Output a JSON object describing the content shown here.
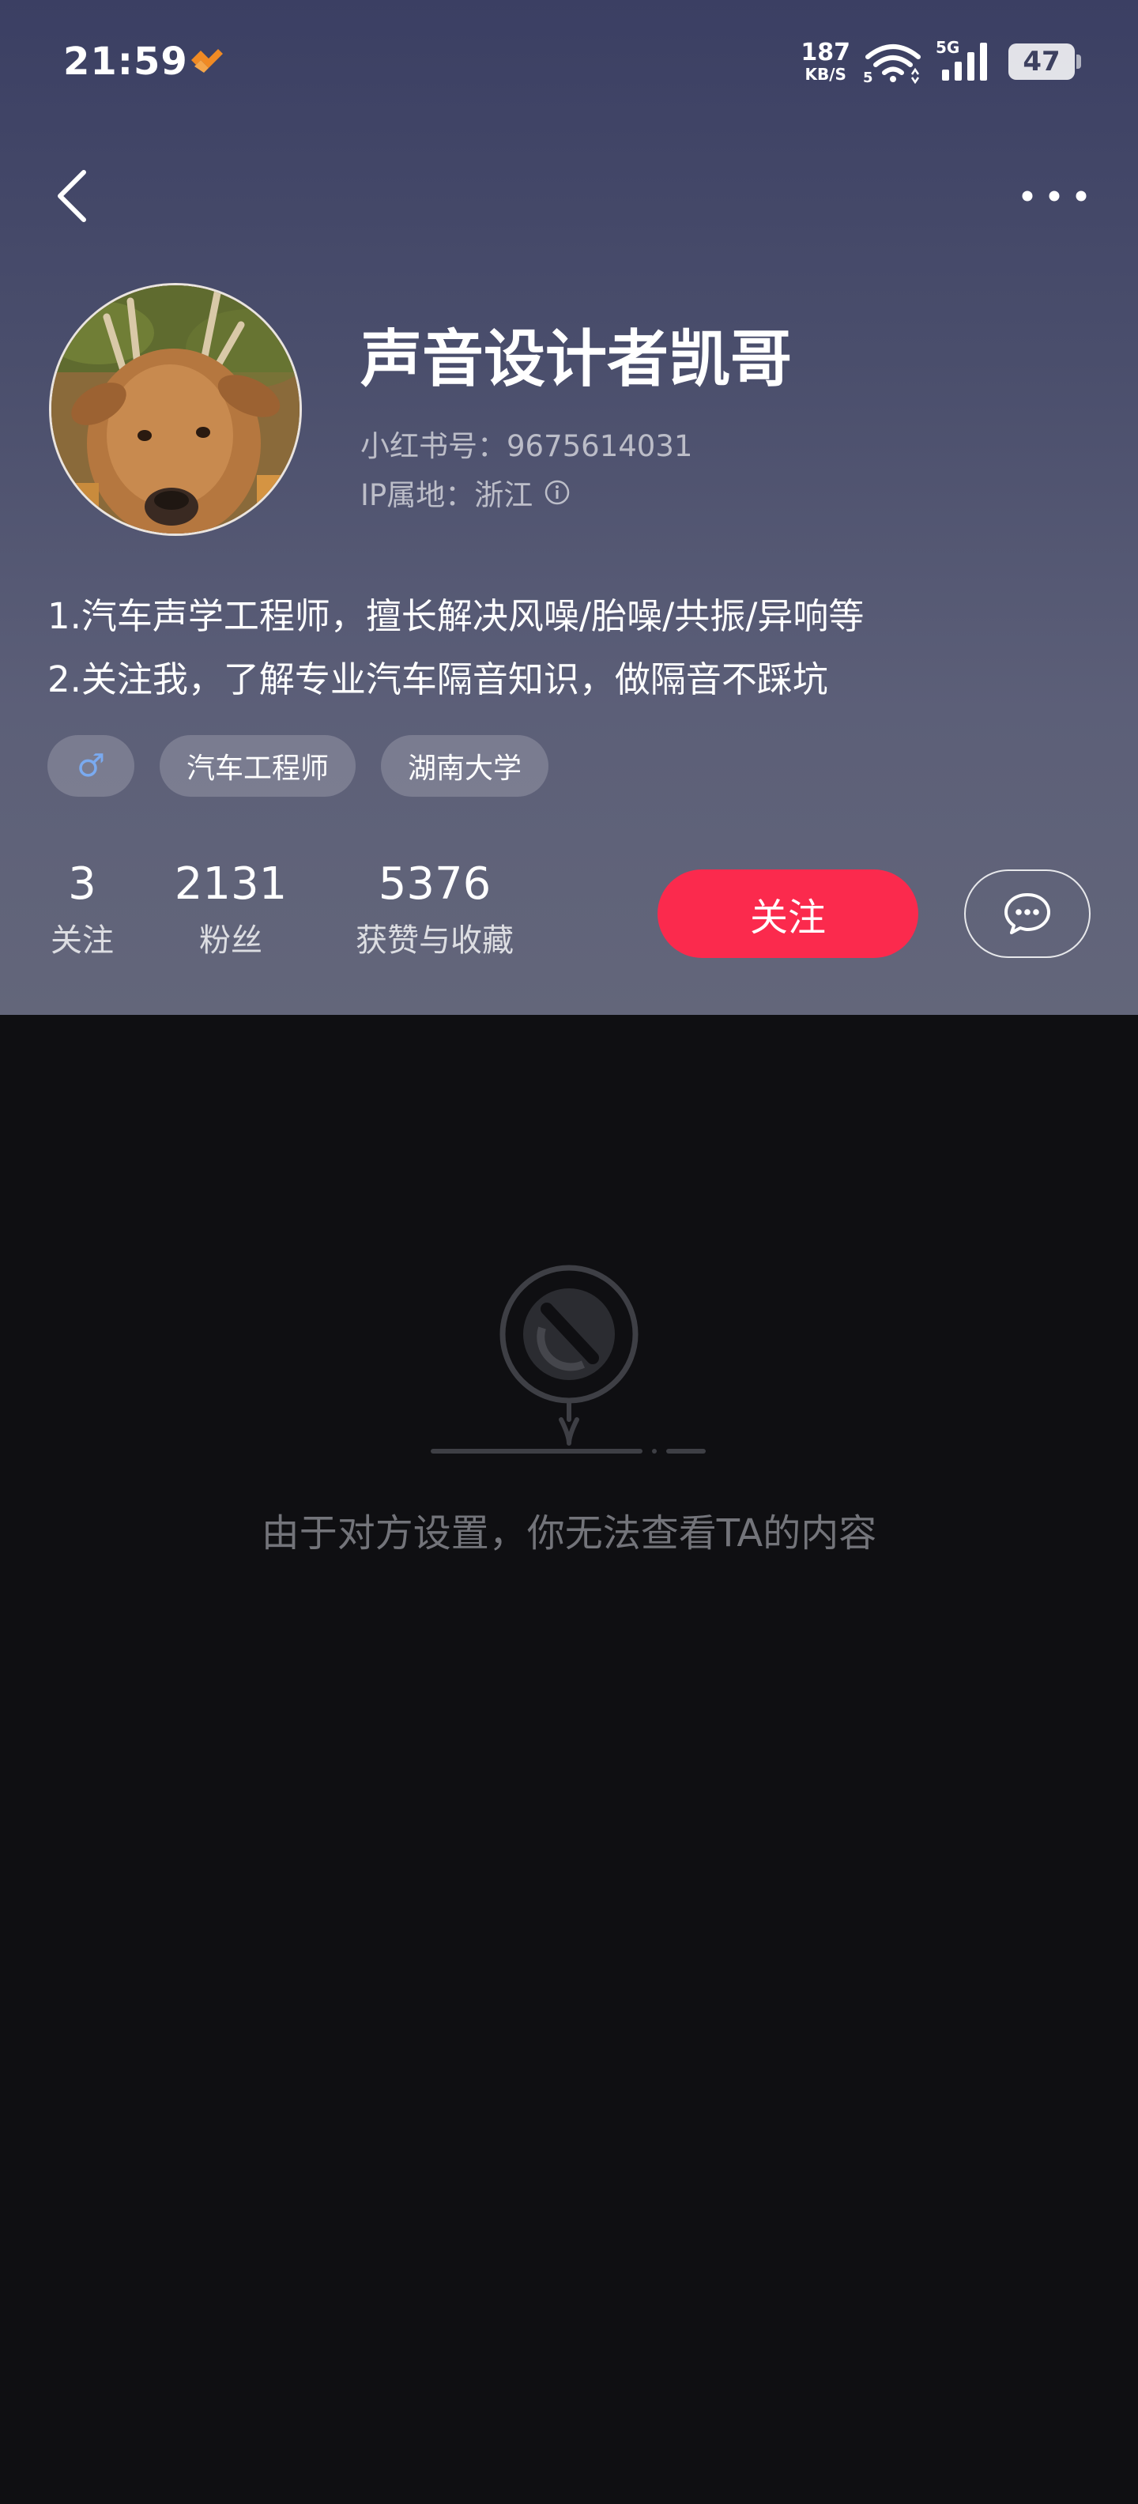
{
  "status_bar": {
    "time": "21:59",
    "net_speed_value": "187",
    "net_speed_unit": "KB/S",
    "signal_label": "5G",
    "battery_level": "47",
    "icons": [
      "app-notification-icon",
      "wifi-icon",
      "cellular-signal-icon",
      "battery-icon"
    ]
  },
  "nav": {
    "back_icon": "chevron-left-icon",
    "more_icon": "more-dots-icon"
  },
  "profile": {
    "name": "声音设计者凯哥",
    "red_id": "小红书号：9675614031",
    "ip_location": "IP属地：浙江",
    "bio_lines": [
      "1.汽车声学工程师，擅长解决风噪/胎噪/共振/异响等",
      "2.关注我，了解专业汽车隔音知识，做隔音不踩坑"
    ],
    "tags": {
      "gender_symbol": "♂",
      "tag_1": "汽车工程师",
      "tag_2": "湖南大学"
    },
    "stats": {
      "following_count": "3",
      "following_label": "关注",
      "followers_count": "2131",
      "followers_label": "粉丝",
      "likes_count": "5376",
      "likes_label": "获赞与收藏"
    },
    "follow_button": "关注",
    "chat_icon": "chat-bubble-icon"
  },
  "content": {
    "empty_message": "由于对方设置，你无法查看TA的内容",
    "illustration": "blocked-sign-icon"
  },
  "colors": {
    "header_gradient_top": "#3b3f63",
    "header_gradient_bottom": "#63667a",
    "follow_button": "#fb2a4d",
    "page_background": "#0f0f12",
    "gender_icon": "#7aaaf0"
  }
}
